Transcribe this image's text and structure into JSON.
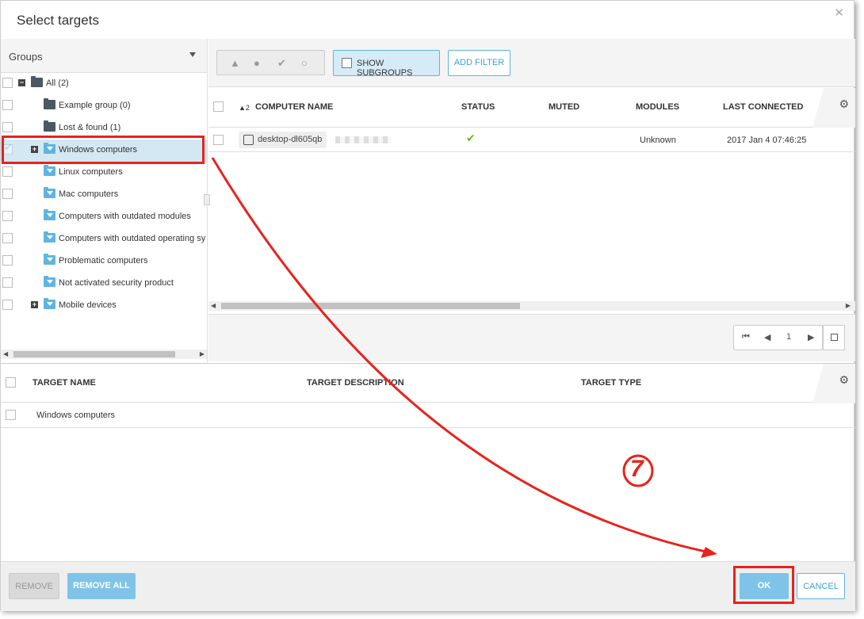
{
  "dialog": {
    "title": "Select targets",
    "close_icon": "close-icon"
  },
  "groups": {
    "header_label": "Groups",
    "items": [
      {
        "label": "All (2)",
        "kind": "static",
        "expander": "−",
        "selected": false
      },
      {
        "label": "Example group (0)",
        "kind": "static",
        "expander": "",
        "selected": false
      },
      {
        "label": "Lost & found (1)",
        "kind": "static",
        "expander": "",
        "selected": false
      },
      {
        "label": "Windows computers",
        "kind": "dynamic",
        "expander": "+",
        "selected": true
      },
      {
        "label": "Linux computers",
        "kind": "dynamic",
        "expander": "",
        "selected": false
      },
      {
        "label": "Mac computers",
        "kind": "dynamic",
        "expander": "",
        "selected": false
      },
      {
        "label": "Computers with outdated modules",
        "kind": "dynamic",
        "expander": "",
        "selected": false
      },
      {
        "label": "Computers with outdated operating sy",
        "kind": "dynamic",
        "expander": "",
        "selected": false
      },
      {
        "label": "Problematic computers",
        "kind": "dynamic",
        "expander": "",
        "selected": false
      },
      {
        "label": "Not activated security product",
        "kind": "dynamic",
        "expander": "",
        "selected": false
      },
      {
        "label": "Mobile devices",
        "kind": "dynamic",
        "expander": "+",
        "selected": false
      }
    ]
  },
  "toolbar": {
    "show_subgroups": "SHOW SUBGROUPS",
    "add_filter": "ADD FILTER",
    "status_icons": [
      "warning-icon",
      "alert-icon",
      "check-icon",
      "circle-icon"
    ]
  },
  "computers": {
    "sort_indicator": "▲2",
    "columns": [
      "COMPUTER NAME",
      "STATUS",
      "MUTED",
      "MODULES",
      "LAST CONNECTED"
    ],
    "rows": [
      {
        "name": "desktop-dl605qb",
        "status": "ok",
        "muted": "",
        "modules": "Unknown",
        "last_connected": "2017 Jan 4 07:46:25"
      }
    ]
  },
  "pager": {
    "page": "1"
  },
  "targets": {
    "columns": [
      "TARGET NAME",
      "TARGET DESCRIPTION",
      "TARGET TYPE"
    ],
    "rows": [
      {
        "name": "Windows computers",
        "description": "",
        "type": ""
      }
    ]
  },
  "footer": {
    "remove": "REMOVE",
    "remove_all": "REMOVE ALL",
    "ok": "OK",
    "cancel": "CANCEL"
  },
  "annotation": {
    "step": "7",
    "color": "#e8221b"
  },
  "colors": {
    "accent": "#5fb5e0",
    "highlight": "#e8221b",
    "ok_status": "#6cb52d"
  }
}
